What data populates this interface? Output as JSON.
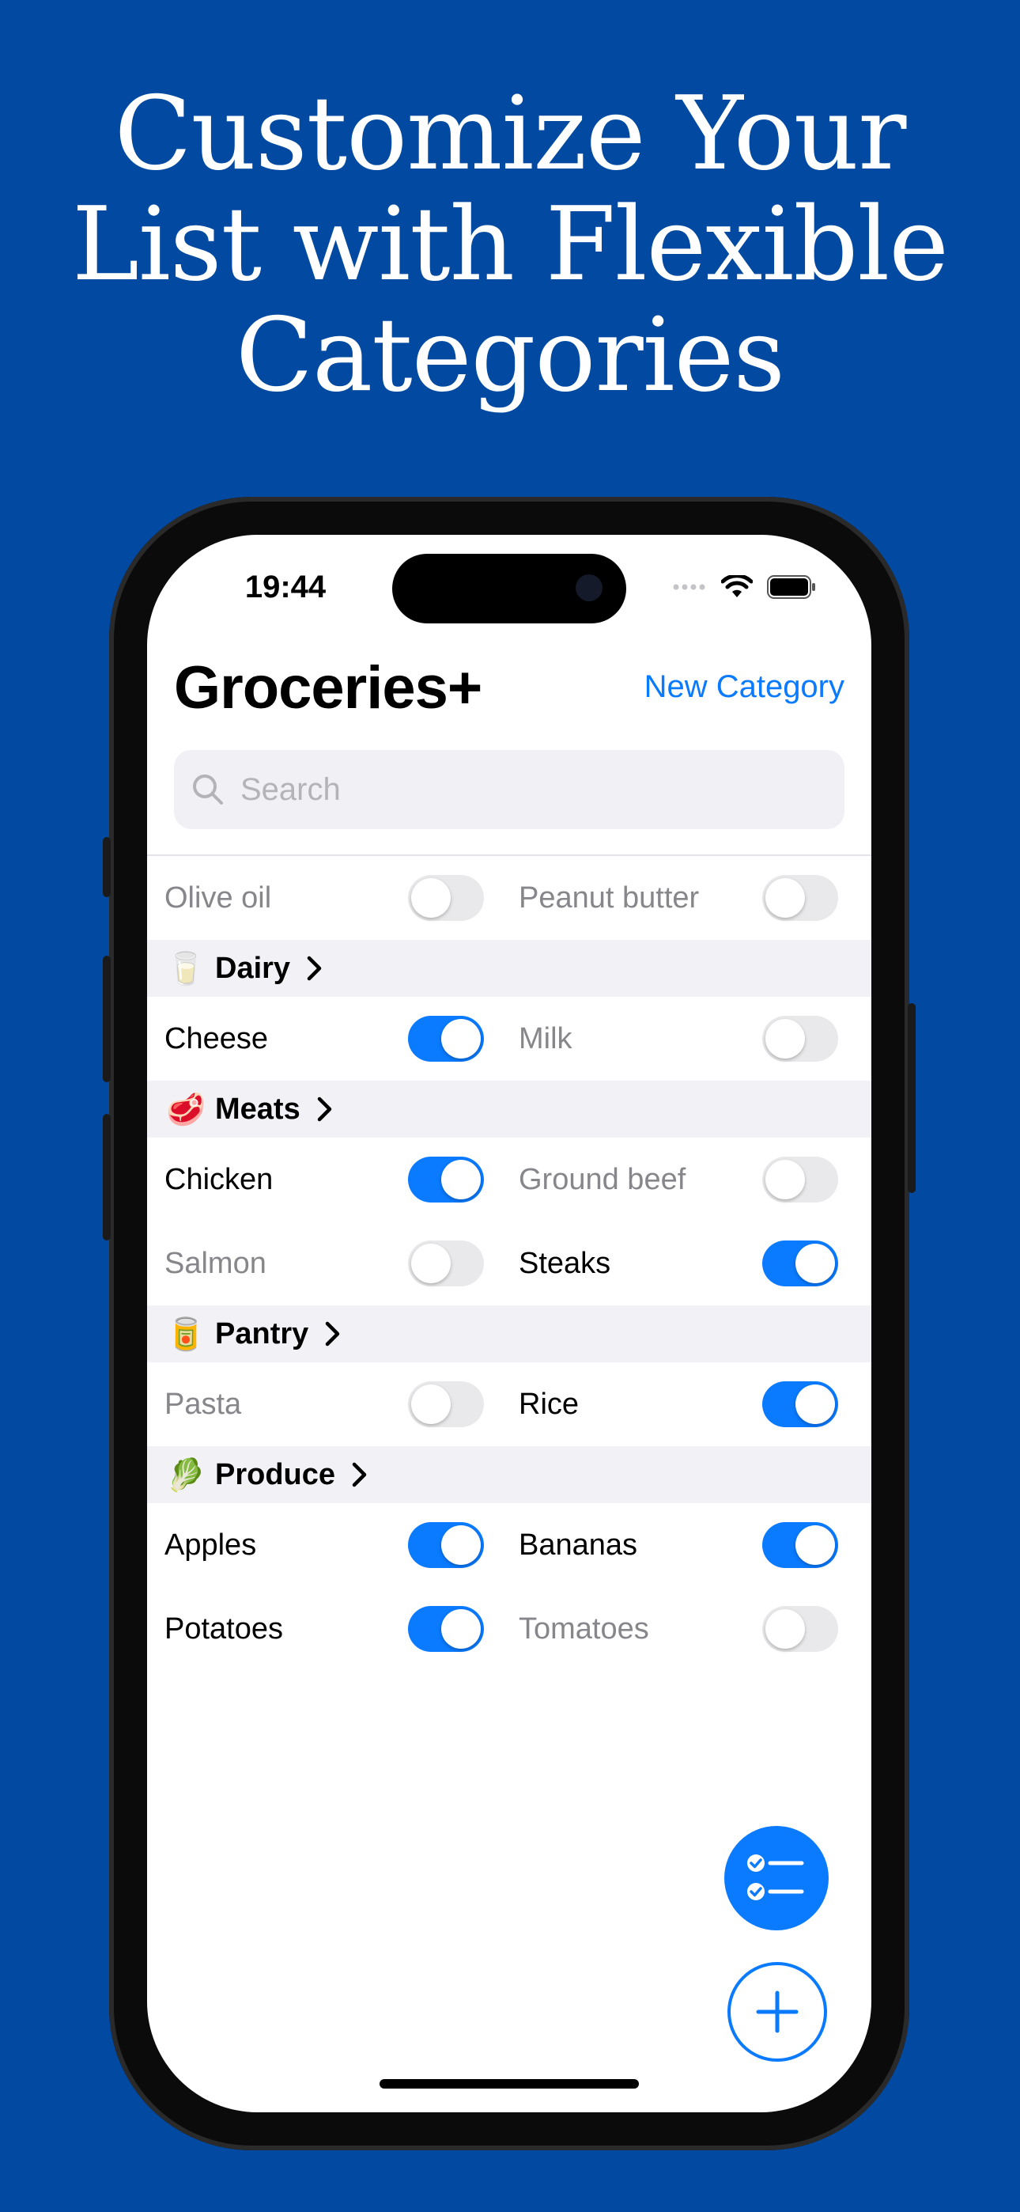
{
  "headline": {
    "line1": "Customize Your",
    "line2": "List with Flexible",
    "line3": "Categories"
  },
  "colors": {
    "background": "#024aa1",
    "accent": "#0a7aff",
    "section_bg": "#f2f2f6"
  },
  "status_bar": {
    "time": "19:44",
    "icons": [
      "signal-icon",
      "wifi-icon",
      "battery-icon"
    ]
  },
  "header": {
    "title": "Groceries+",
    "new_category_label": "New Category"
  },
  "search": {
    "placeholder": "Search",
    "value": "",
    "icon": "search-icon"
  },
  "uncategorized": [
    {
      "name": "Olive oil",
      "on": false
    },
    {
      "name": "Peanut butter",
      "on": false
    }
  ],
  "categories": [
    {
      "emoji": "🥛",
      "name": "Dairy",
      "items": [
        {
          "name": "Cheese",
          "on": true
        },
        {
          "name": "Milk",
          "on": false
        }
      ]
    },
    {
      "emoji": "🥩",
      "name": "Meats",
      "items": [
        {
          "name": "Chicken",
          "on": true
        },
        {
          "name": "Ground beef",
          "on": false
        },
        {
          "name": "Salmon",
          "on": false
        },
        {
          "name": "Steaks",
          "on": true
        }
      ]
    },
    {
      "emoji": "🥫",
      "name": "Pantry",
      "items": [
        {
          "name": "Pasta",
          "on": false
        },
        {
          "name": "Rice",
          "on": true
        }
      ]
    },
    {
      "emoji": "🥬",
      "name": "Produce",
      "items": [
        {
          "name": "Apples",
          "on": true
        },
        {
          "name": "Bananas",
          "on": true
        },
        {
          "name": "Potatoes",
          "on": true
        },
        {
          "name": "Tomatoes",
          "on": false
        }
      ]
    }
  ],
  "fab": {
    "checklist_icon": "checklist-icon",
    "add_icon": "plus-icon"
  }
}
